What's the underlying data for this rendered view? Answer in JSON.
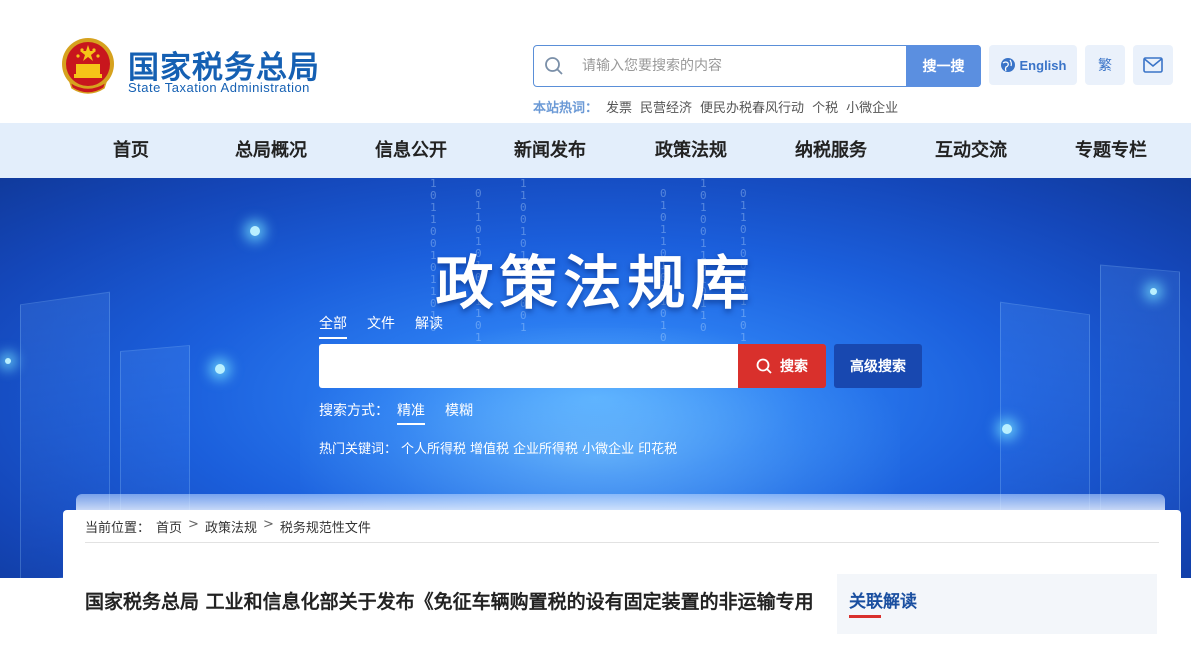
{
  "header": {
    "site_name": "国家税务总局",
    "site_name_en": "State Taxation Administration",
    "search": {
      "placeholder": "请输入您要搜索的内容",
      "button": "搜一搜"
    },
    "english_label": "English",
    "traditional_label": "繁",
    "hot": {
      "label": "本站热词：",
      "items": [
        "发票",
        "民营经济",
        "便民办税春风行动",
        "个税",
        "小微企业"
      ]
    }
  },
  "nav": {
    "items": [
      "首页",
      "总局概况",
      "信息公开",
      "新闻发布",
      "政策法规",
      "纳税服务",
      "互动交流",
      "专题专栏"
    ]
  },
  "banner": {
    "title": "政策法规库",
    "tabs": [
      "全部",
      "文件",
      "解读"
    ],
    "active_tab": "全部",
    "search_button": "搜索",
    "advanced_button": "高级搜索",
    "mode_label": "搜索方式：",
    "modes": [
      "精准",
      "模糊"
    ],
    "active_mode": "精准",
    "hot_keywords_label": "热门关键词：",
    "hot_keywords": [
      "个人所得税",
      "增值税",
      "企业所得税",
      "小微企业",
      "印花税"
    ]
  },
  "breadcrumb": {
    "prefix": "当前位置：",
    "items": [
      "首页",
      "政策法规",
      "税务规范性文件"
    ],
    "separator": ">"
  },
  "article": {
    "title": "国家税务总局 工业和信息化部关于发布《免征车辆购置税的设有固定装置的非运输专用"
  },
  "sidebar": {
    "related_title": "关联解读"
  },
  "colors": {
    "brand_blue": "#1560b3",
    "nav_bg": "#e3eefb",
    "search_red": "#d9302c",
    "advanced_blue": "#1848b0"
  }
}
